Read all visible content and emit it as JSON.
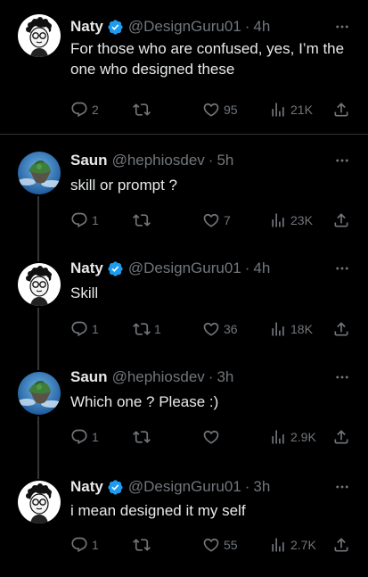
{
  "colors": {
    "background": "#000000",
    "text": "#e7e9ea",
    "muted": "#71767b",
    "verified": "#1d9bf0"
  },
  "tweets": [
    {
      "name": "Naty",
      "handle": "@DesignGuru01",
      "time": "4h",
      "verified": true,
      "avatar": "cartoon-avatar",
      "text": "For those who are confused, yes, I’m the one who designed these",
      "replies": "2",
      "retweets": "",
      "likes": "95",
      "views": "21K"
    },
    {
      "name": "Saun",
      "handle": "@hephiosdev",
      "time": "5h",
      "verified": false,
      "avatar": "floating-island-avatar",
      "text": "skill or prompt ?",
      "replies": "1",
      "retweets": "",
      "likes": "7",
      "views": "23K"
    },
    {
      "name": "Naty",
      "handle": "@DesignGuru01",
      "time": "4h",
      "verified": true,
      "avatar": "cartoon-avatar",
      "text": "Skill",
      "replies": "1",
      "retweets": "1",
      "likes": "36",
      "views": "18K"
    },
    {
      "name": "Saun",
      "handle": "@hephiosdev",
      "time": "3h",
      "verified": false,
      "avatar": "floating-island-avatar",
      "text": "Which one ? Please :)",
      "replies": "1",
      "retweets": "",
      "likes": "",
      "views": "2.9K"
    },
    {
      "name": "Naty",
      "handle": "@DesignGuru01",
      "time": "3h",
      "verified": true,
      "avatar": "cartoon-avatar",
      "text": "i mean designed it my self",
      "replies": "1",
      "retweets": "",
      "likes": "55",
      "views": "2.7K"
    }
  ],
  "separator": "·"
}
